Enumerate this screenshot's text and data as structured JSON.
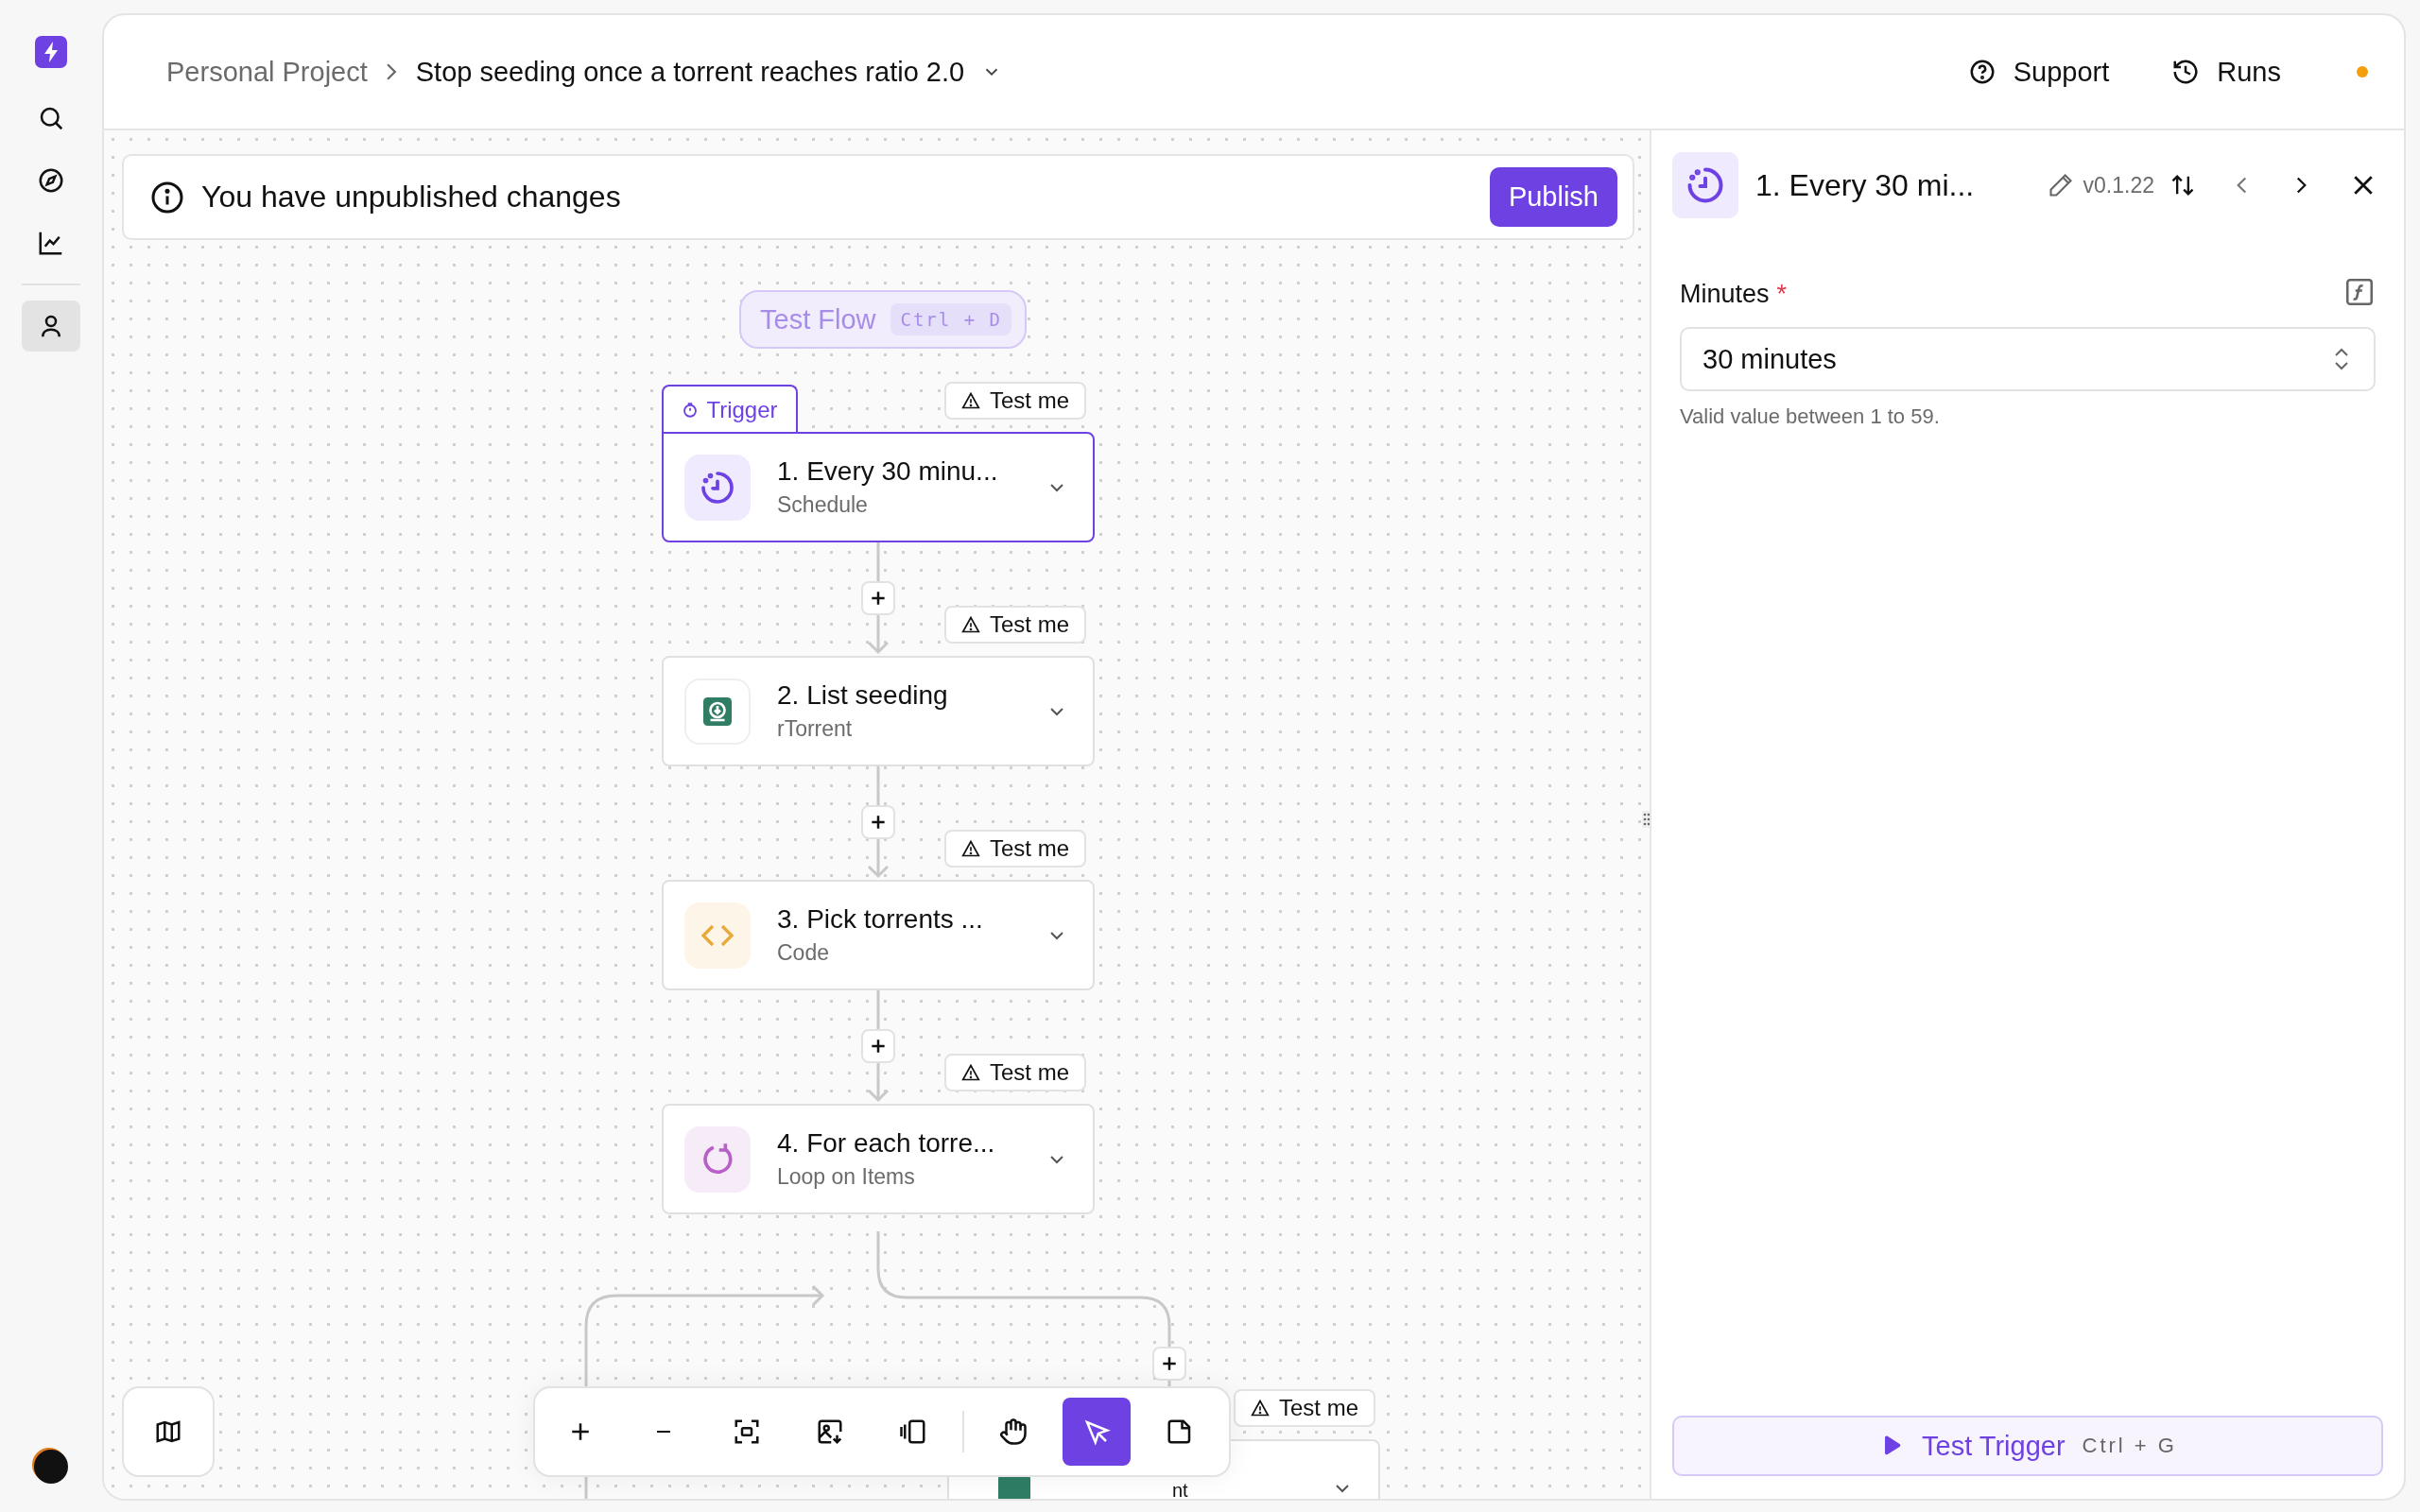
{
  "nav": [
    {
      "kind": "search",
      "selected": false
    },
    {
      "kind": "explore",
      "selected": false
    },
    {
      "kind": "chart",
      "selected": false
    },
    {
      "kind": "user",
      "selected": true
    }
  ],
  "breadcrumb": {
    "project": "Personal Project",
    "flow": "Stop seeding once a torrent reaches ratio 2.0"
  },
  "header_actions": [
    {
      "kind": "support",
      "label": "Support"
    },
    {
      "kind": "runs",
      "label": "Runs"
    }
  ],
  "banner": {
    "message": "You have unpublished changes",
    "button": "Publish"
  },
  "test_flow": {
    "label": "Test Flow",
    "shortcut": "Ctrl + D"
  },
  "trigger_tab": "Trigger",
  "steps": [
    {
      "kind": "schedule",
      "title": "1. Every 30 minu...",
      "subtitle": "Schedule",
      "selected": true,
      "test_label": "Test me"
    },
    {
      "kind": "rtorrent",
      "title": "2. List seeding",
      "subtitle": "rTorrent",
      "selected": false,
      "test_label": "Test me"
    },
    {
      "kind": "code",
      "title": "3. Pick torrents ...",
      "subtitle": "Code",
      "selected": false,
      "test_label": "Test me"
    },
    {
      "kind": "loop",
      "title": "4. For each torre...",
      "subtitle": "Loop on Items",
      "selected": false,
      "test_label": "Test me"
    }
  ],
  "partial_step": {
    "kind": "rtorrent",
    "title": "nt",
    "test_label": "Test me"
  },
  "toolbar": [
    {
      "kind": "zoom-in",
      "selected": false
    },
    {
      "kind": "zoom-out",
      "selected": false
    },
    {
      "kind": "fit",
      "selected": false
    },
    {
      "kind": "export",
      "selected": false
    },
    {
      "kind": "panel",
      "selected": false
    },
    {
      "kind": "hand",
      "selected": false
    },
    {
      "kind": "pointer",
      "selected": true
    },
    {
      "kind": "note",
      "selected": false
    }
  ],
  "panel": {
    "title": "1. Every 30 mi...",
    "version": "v0.1.22",
    "field": {
      "label": "Minutes",
      "required": true,
      "required_mark": "*",
      "value": "30 minutes",
      "help": "Valid value between 1 to 59."
    },
    "test_button": {
      "label": "Test Trigger",
      "shortcut": "Ctrl + G"
    }
  }
}
